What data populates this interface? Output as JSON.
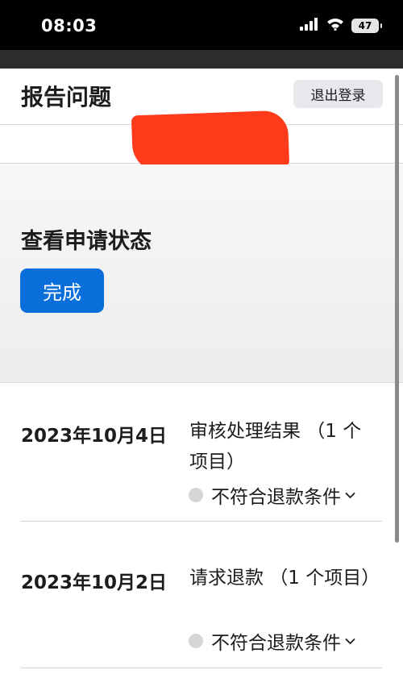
{
  "status_bar": {
    "time": "08:03",
    "battery": "47"
  },
  "header": {
    "title": "报告问题",
    "logout_label": "退出登录"
  },
  "status_section": {
    "title": "查看申请状态",
    "done_label": "完成"
  },
  "requests": [
    {
      "date": "2023年10月4日",
      "description": "审核处理结果 （1 个项目）",
      "status": "不符合退款条件"
    },
    {
      "date": "2023年10月2日",
      "description": "请求退款 （1 个项目）",
      "status": "不符合退款条件"
    }
  ],
  "colors": {
    "accent": "#0a6fdb",
    "redaction": "#ff3b1c",
    "status_bar": "#000000"
  },
  "icons": [
    "signal-icon",
    "wifi-icon",
    "battery-icon",
    "chevron-down-icon"
  ]
}
